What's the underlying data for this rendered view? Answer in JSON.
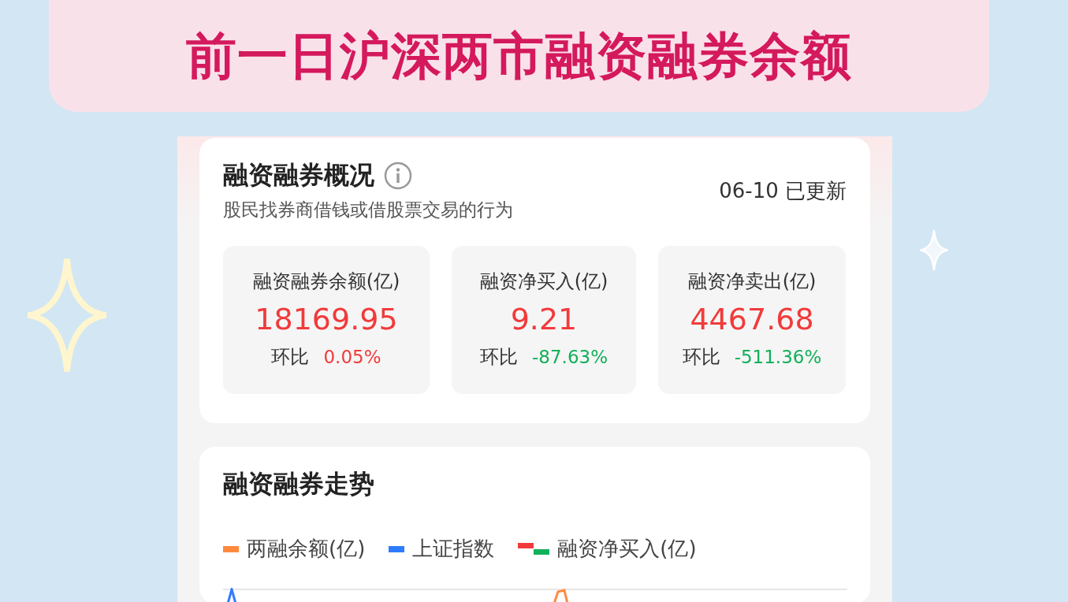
{
  "banner": {
    "title": "前一日沪深两市融资融券余额"
  },
  "overview": {
    "title": "融资融券概况",
    "subtitle": "股民找券商借钱或借股票交易的行为",
    "updated": "06-10 已更新",
    "metrics": [
      {
        "label": "融资融券余额(亿)",
        "value": "18169.95",
        "change_label": "环比",
        "change": "0.05%",
        "rising": true
      },
      {
        "label": "融资净买入(亿)",
        "value": "9.21",
        "change_label": "环比",
        "change": "-87.63%",
        "rising": false
      },
      {
        "label": "融资净卖出(亿)",
        "value": "4467.68",
        "change_label": "环比",
        "change": "-511.36%",
        "rising": false
      }
    ]
  },
  "trend": {
    "title": "融资融券走势",
    "legend": [
      {
        "label": "两融余额(亿)",
        "kind": "line",
        "color": "#ff8a3d"
      },
      {
        "label": "上证指数",
        "kind": "line",
        "color": "#2f7bff"
      },
      {
        "label": "融资净买入(亿)",
        "kind": "bar",
        "color": "#f23a3a"
      }
    ]
  }
}
